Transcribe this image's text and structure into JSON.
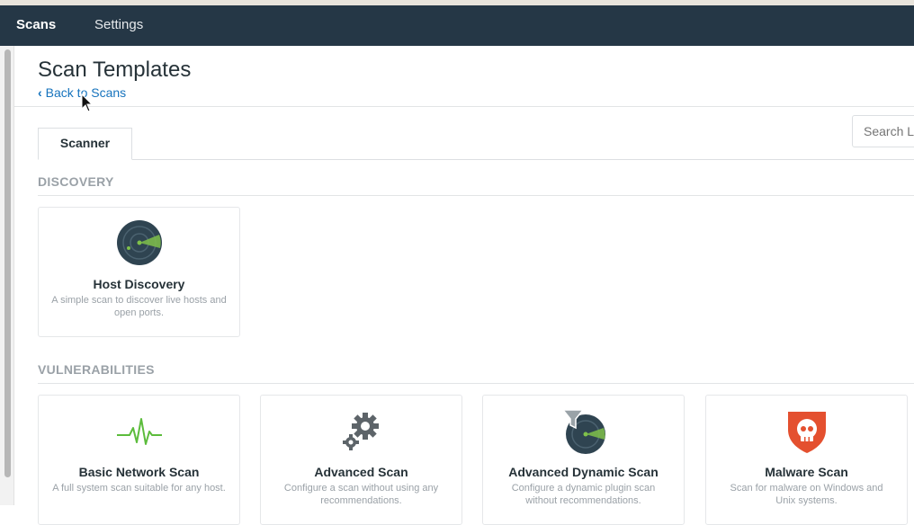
{
  "nav": {
    "tabs": [
      {
        "label": "Scans",
        "active": true
      },
      {
        "label": "Settings",
        "active": false
      }
    ]
  },
  "header": {
    "title": "Scan Templates",
    "back_link": "Back to Scans"
  },
  "tabs": [
    {
      "label": "Scanner",
      "active": true
    }
  ],
  "search": {
    "placeholder": "Search Library"
  },
  "sections": [
    {
      "title": "DISCOVERY",
      "cards": [
        {
          "title": "Host Discovery",
          "description": "A simple scan to discover live hosts and open ports.",
          "icon": "radar-icon"
        }
      ]
    },
    {
      "title": "VULNERABILITIES",
      "cards": [
        {
          "title": "Basic Network Scan",
          "description": "A full system scan suitable for any host.",
          "icon": "pulse-icon"
        },
        {
          "title": "Advanced Scan",
          "description": "Configure a scan without using any recommendations.",
          "icon": "gears-icon"
        },
        {
          "title": "Advanced Dynamic Scan",
          "description": "Configure a dynamic plugin scan without recommendations.",
          "icon": "radar-filter-icon"
        },
        {
          "title": "Malware Scan",
          "description": "Scan for malware on Windows and Unix systems.",
          "icon": "skull-shield-icon"
        }
      ]
    }
  ],
  "colors": {
    "navbar": "#253746",
    "link": "#1673bd",
    "radar": "#2f4451",
    "radar_accent": "#7fc04a",
    "pulse": "#5cbc3c",
    "gears": "#5d6469",
    "malware": "#e4502f"
  }
}
